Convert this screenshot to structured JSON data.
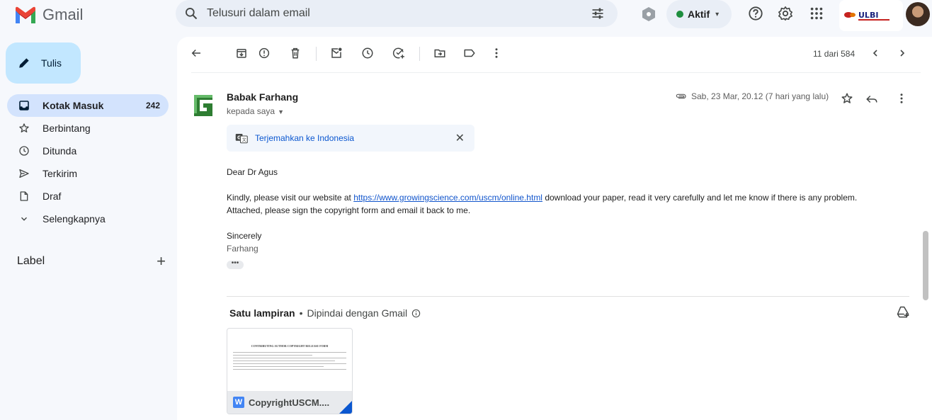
{
  "app": {
    "name": "Gmail"
  },
  "search": {
    "placeholder": "Telusuri dalam email"
  },
  "status": {
    "label": "Aktif",
    "color": "#1e8e3e"
  },
  "org": {
    "logo_text": "ULBI"
  },
  "sidebar": {
    "compose_label": "Tulis",
    "items": [
      {
        "label": "Kotak Masuk",
        "count": "242",
        "icon": "inbox-icon"
      },
      {
        "label": "Berbintang",
        "icon": "star-icon"
      },
      {
        "label": "Ditunda",
        "icon": "clock-icon"
      },
      {
        "label": "Terkirim",
        "icon": "send-icon"
      },
      {
        "label": "Draf",
        "icon": "draft-icon"
      },
      {
        "label": "Selengkapnya",
        "icon": "chevron-down-icon"
      }
    ],
    "label_heading": "Label"
  },
  "toolbar": {
    "pager": "11 dari 584"
  },
  "message": {
    "sender": "Babak Farhang",
    "to_line": "kepada saya",
    "date": "Sab, 23 Mar, 20.12 (7 hari yang lalu)",
    "translate_label": "Terjemahkan ke Indonesia",
    "greeting": "Dear Dr Agus",
    "body_before_link": "Kindly, please visit our website at ",
    "link": "https://www.growingscience.com/uscm/online.html",
    "body_after_link": " download your paper, read it very carefully and let me know if there is any problem.",
    "body_line2": "Attached, please sign the copyright form and email it back to me.",
    "closing": "Sincerely",
    "signer": "Farhang"
  },
  "attachments": {
    "heading": "Satu lampiran",
    "scanned": "Dipindai dengan Gmail",
    "file": {
      "name": "CopyrightUSCM....",
      "preview_title": "CONTRIBUTING AUTHOR COPYRIGHT RELEASE FORM"
    }
  }
}
